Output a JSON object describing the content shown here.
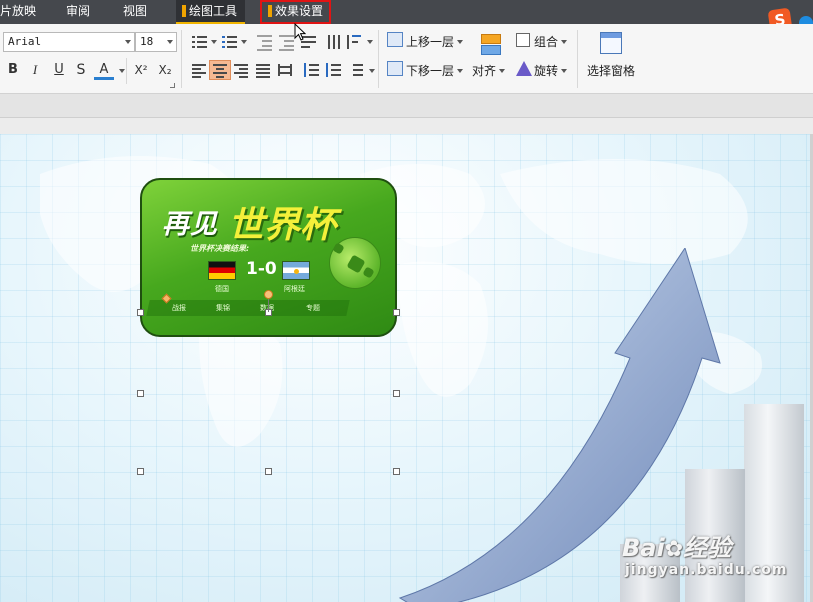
{
  "tabs": [
    {
      "label": "片放映",
      "active": false
    },
    {
      "label": "审阅",
      "active": false
    },
    {
      "label": "视图",
      "active": false
    },
    {
      "label": "绘图工具",
      "active": true
    },
    {
      "label": "效果设置",
      "active": false,
      "highlighted": true
    }
  ],
  "sogou_logo": "S",
  "font": {
    "family": "Arial",
    "size": "18"
  },
  "format_buttons": [
    "B",
    "I",
    "U",
    "S",
    "A",
    "X²",
    "X₂"
  ],
  "ribbon": {
    "bring_forward": "上移一层",
    "send_backward": "下移一层",
    "align": "对齐",
    "group": "组合",
    "rotate": "旋转",
    "selection_pane": "选择窗格"
  },
  "banner": {
    "title_part1": "再见",
    "title_part2": "世界杯",
    "subtitle": "世界杯决赛结果:",
    "score": "1-0",
    "team_left": "德国",
    "team_right": "阿根廷",
    "menu": [
      "战报",
      "集锦",
      "数据",
      "专题"
    ]
  },
  "watermark": {
    "logo_text": "Bai",
    "logo_text2": "经验",
    "url": "jingyan.baidu.com"
  },
  "colors": {
    "tabbar": "#45484d",
    "highlight_box": "#e01414",
    "accent_tab": "#f0b400",
    "banner_green": "#47a81e"
  }
}
